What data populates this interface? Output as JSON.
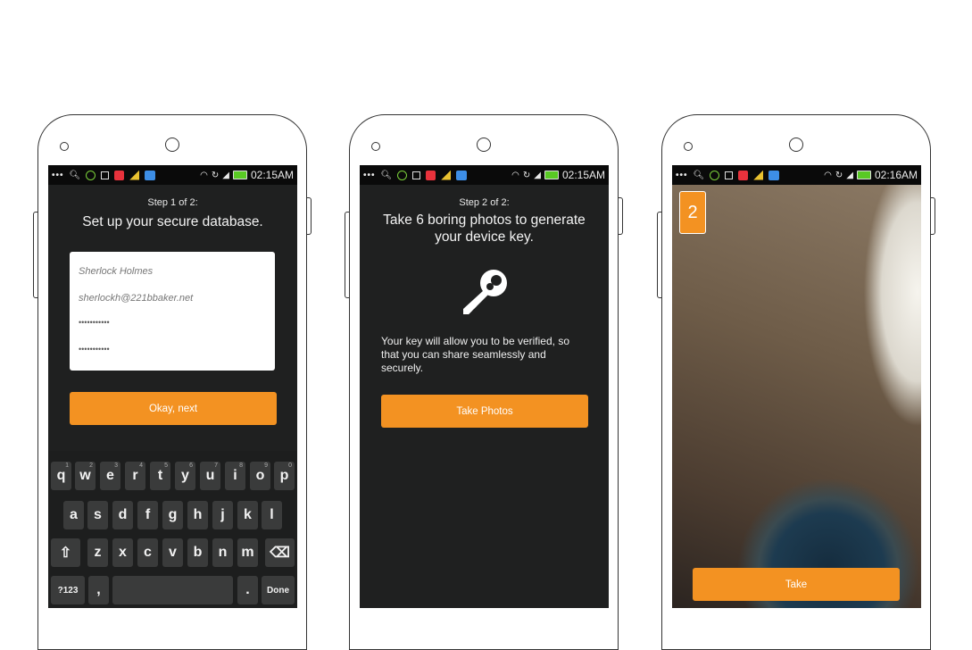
{
  "status_bar": {
    "phone1_time": "02:15AM",
    "phone2_time": "02:15AM",
    "phone3_time": "02:16AM",
    "icons": [
      "more-icon",
      "search-icon",
      "green-circle-icon",
      "grid-icon",
      "red-app-icon",
      "yellow-app-icon",
      "blue-app-icon",
      "wifi-icon",
      "sync-icon",
      "signal-icon",
      "battery-icon"
    ]
  },
  "screen1": {
    "step": "Step 1 of 2:",
    "title": "Set up your secure database.",
    "fields": {
      "name": "Sherlock Holmes",
      "email": "sherlockh@221bbaker.net",
      "password": "•••••••••••",
      "confirm_password": "•••••••••••"
    },
    "next_button": "Okay, next",
    "keyboard": {
      "row1": [
        "q",
        "w",
        "e",
        "r",
        "t",
        "y",
        "u",
        "i",
        "o",
        "p"
      ],
      "row1_sup": [
        "1",
        "2",
        "3",
        "4",
        "5",
        "6",
        "7",
        "8",
        "9",
        "0"
      ],
      "row2": [
        "a",
        "s",
        "d",
        "f",
        "g",
        "h",
        "j",
        "k",
        "l"
      ],
      "row3": [
        "z",
        "x",
        "c",
        "v",
        "b",
        "n",
        "m"
      ],
      "shift": "⇧",
      "backspace": "⌫",
      "symbols": "?123",
      "comma": ",",
      "period": ".",
      "done": "Done"
    }
  },
  "screen2": {
    "step": "Step 2 of 2:",
    "title": "Take 6 boring photos to generate your device key.",
    "description": "Your key will allow you to be verified, so that you can share seamlessly and securely.",
    "button": "Take Photos"
  },
  "screen3": {
    "counter": "2",
    "button": "Take"
  },
  "colors": {
    "accent": "#f39222",
    "screen_bg": "#1f2020",
    "statusbar_bg": "#0a0a0a"
  }
}
